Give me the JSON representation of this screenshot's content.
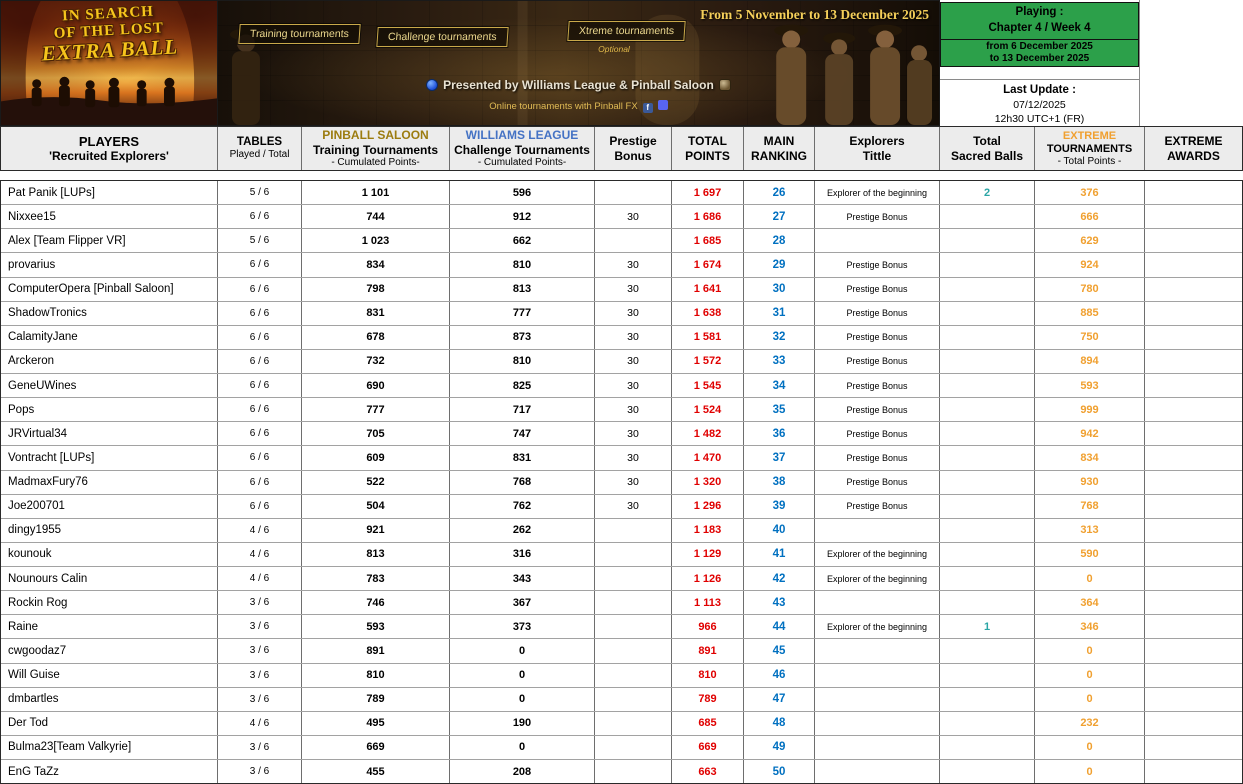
{
  "banner": {
    "left_poster": {
      "title_lines": [
        "IN SEARCH",
        "OF THE LOST",
        "EXTRA BALL"
      ]
    },
    "middle": {
      "date_range": "From 5 November to 13 December 2025",
      "tournament_labels": [
        "Training tournaments",
        "Challenge tournaments",
        "Xtreme tournaments"
      ],
      "xtreme_optional": "Optional",
      "presented_by": "Presented by Williams League & Pinball Saloon",
      "online_line": "Online tournaments with Pinball FX"
    },
    "right": {
      "playing_label": "Playing :",
      "playing_value": "Chapter 4 / Week 4",
      "playing_from": "from 6 December 2025",
      "playing_to": "to 13 December 2025",
      "last_update_label": "Last Update :",
      "last_update_date": "07/12/2025",
      "last_update_time": "12h30 UTC+1 (FR)"
    }
  },
  "icons": {
    "williams_league_icon": "circle-blue",
    "pinball_saloon_icon": "square-sepia",
    "facebook_icon": "f",
    "discord_icon": ""
  },
  "colors": {
    "total_points": "#e00000",
    "main_ranking": "#0070c0",
    "extreme": "#f0a030",
    "sacred_balls": "#2aa5a5",
    "pinball_saloon": "#9c7c10",
    "williams_league": "#4472c4",
    "playing_green": "#2ca04a"
  },
  "table": {
    "headers": {
      "players": {
        "line1": "PLAYERS",
        "line2": "'Recruited Explorers'"
      },
      "tables": {
        "line1": "TABLES",
        "line2": "Played / Total"
      },
      "training": {
        "brand": "PINBALL SALOON",
        "line2": "Training Tournaments",
        "line3": "- Cumulated Points-"
      },
      "challenge": {
        "brand": "WILLIAMS LEAGUE",
        "line2": "Challenge Tournaments",
        "line3": "- Cumulated Points-"
      },
      "prestige": {
        "line1": "Prestige",
        "line2": "Bonus"
      },
      "total": {
        "line1": "TOTAL",
        "line2": "POINTS"
      },
      "ranking": {
        "line1": "MAIN",
        "line2": "RANKING"
      },
      "explorers": {
        "line1": "Explorers",
        "line2": "Tittle"
      },
      "sacred": {
        "line1": "Total",
        "line2": "Sacred Balls"
      },
      "extreme": {
        "brand": "EXTREME",
        "line2": "TOURNAMENTS",
        "line3": "- Total Points -"
      },
      "awards": {
        "line1": "EXTREME",
        "line2": "AWARDS"
      }
    },
    "rows": [
      {
        "name": "Pat Panik [LUPs]",
        "tables": "5 / 6",
        "training": "1 101",
        "challenge": "596",
        "prestige": "",
        "total": "1 697",
        "ranking": "26",
        "title": "Explorer of the beginning",
        "sacred": "2",
        "extreme": "376",
        "awards": ""
      },
      {
        "name": "Nixxee15",
        "tables": "6 / 6",
        "training": "744",
        "challenge": "912",
        "prestige": "30",
        "total": "1 686",
        "ranking": "27",
        "title": "Prestige Bonus",
        "sacred": "",
        "extreme": "666",
        "awards": ""
      },
      {
        "name": "Alex [Team Flipper VR]",
        "tables": "5 / 6",
        "training": "1 023",
        "challenge": "662",
        "prestige": "",
        "total": "1 685",
        "ranking": "28",
        "title": "",
        "sacred": "",
        "extreme": "629",
        "awards": ""
      },
      {
        "name": "provarius",
        "tables": "6 / 6",
        "training": "834",
        "challenge": "810",
        "prestige": "30",
        "total": "1 674",
        "ranking": "29",
        "title": "Prestige Bonus",
        "sacred": "",
        "extreme": "924",
        "awards": ""
      },
      {
        "name": "ComputerOpera [Pinball Saloon]",
        "tables": "6 / 6",
        "training": "798",
        "challenge": "813",
        "prestige": "30",
        "total": "1 641",
        "ranking": "30",
        "title": "Prestige Bonus",
        "sacred": "",
        "extreme": "780",
        "awards": ""
      },
      {
        "name": "ShadowTronics",
        "tables": "6 / 6",
        "training": "831",
        "challenge": "777",
        "prestige": "30",
        "total": "1 638",
        "ranking": "31",
        "title": "Prestige Bonus",
        "sacred": "",
        "extreme": "885",
        "awards": ""
      },
      {
        "name": "CalamityJane",
        "tables": "6 / 6",
        "training": "678",
        "challenge": "873",
        "prestige": "30",
        "total": "1 581",
        "ranking": "32",
        "title": "Prestige Bonus",
        "sacred": "",
        "extreme": "750",
        "awards": ""
      },
      {
        "name": "Arckeron",
        "tables": "6 / 6",
        "training": "732",
        "challenge": "810",
        "prestige": "30",
        "total": "1 572",
        "ranking": "33",
        "title": "Prestige Bonus",
        "sacred": "",
        "extreme": "894",
        "awards": ""
      },
      {
        "name": "GeneUWines",
        "tables": "6 / 6",
        "training": "690",
        "challenge": "825",
        "prestige": "30",
        "total": "1 545",
        "ranking": "34",
        "title": "Prestige Bonus",
        "sacred": "",
        "extreme": "593",
        "awards": ""
      },
      {
        "name": "Pops",
        "tables": "6 / 6",
        "training": "777",
        "challenge": "717",
        "prestige": "30",
        "total": "1 524",
        "ranking": "35",
        "title": "Prestige Bonus",
        "sacred": "",
        "extreme": "999",
        "awards": ""
      },
      {
        "name": "JRVirtual34",
        "tables": "6 / 6",
        "training": "705",
        "challenge": "747",
        "prestige": "30",
        "total": "1 482",
        "ranking": "36",
        "title": "Prestige Bonus",
        "sacred": "",
        "extreme": "942",
        "awards": ""
      },
      {
        "name": "Vontracht [LUPs]",
        "tables": "6 / 6",
        "training": "609",
        "challenge": "831",
        "prestige": "30",
        "total": "1 470",
        "ranking": "37",
        "title": "Prestige Bonus",
        "sacred": "",
        "extreme": "834",
        "awards": ""
      },
      {
        "name": "MadmaxFury76",
        "tables": "6 / 6",
        "training": "522",
        "challenge": "768",
        "prestige": "30",
        "total": "1 320",
        "ranking": "38",
        "title": "Prestige Bonus",
        "sacred": "",
        "extreme": "930",
        "awards": ""
      },
      {
        "name": "Joe200701",
        "tables": "6 / 6",
        "training": "504",
        "challenge": "762",
        "prestige": "30",
        "total": "1 296",
        "ranking": "39",
        "title": "Prestige Bonus",
        "sacred": "",
        "extreme": "768",
        "awards": ""
      },
      {
        "name": "dingy1955",
        "tables": "4 / 6",
        "training": "921",
        "challenge": "262",
        "prestige": "",
        "total": "1 183",
        "ranking": "40",
        "title": "",
        "sacred": "",
        "extreme": "313",
        "awards": ""
      },
      {
        "name": "kounouk",
        "tables": "4 / 6",
        "training": "813",
        "challenge": "316",
        "prestige": "",
        "total": "1 129",
        "ranking": "41",
        "title": "Explorer of the beginning",
        "sacred": "",
        "extreme": "590",
        "awards": ""
      },
      {
        "name": "Nounours Calin",
        "tables": "4 / 6",
        "training": "783",
        "challenge": "343",
        "prestige": "",
        "total": "1 126",
        "ranking": "42",
        "title": "Explorer of the beginning",
        "sacred": "",
        "extreme": "0",
        "awards": ""
      },
      {
        "name": "Rockin Rog",
        "tables": "3 / 6",
        "training": "746",
        "challenge": "367",
        "prestige": "",
        "total": "1 113",
        "ranking": "43",
        "title": "",
        "sacred": "",
        "extreme": "364",
        "awards": ""
      },
      {
        "name": "Raine",
        "tables": "3 / 6",
        "training": "593",
        "challenge": "373",
        "prestige": "",
        "total": "966",
        "ranking": "44",
        "title": "Explorer of the beginning",
        "sacred": "1",
        "extreme": "346",
        "awards": ""
      },
      {
        "name": "cwgoodaz7",
        "tables": "3 / 6",
        "training": "891",
        "challenge": "0",
        "prestige": "",
        "total": "891",
        "ranking": "45",
        "title": "",
        "sacred": "",
        "extreme": "0",
        "awards": ""
      },
      {
        "name": "Will Guise",
        "tables": "3 / 6",
        "training": "810",
        "challenge": "0",
        "prestige": "",
        "total": "810",
        "ranking": "46",
        "title": "",
        "sacred": "",
        "extreme": "0",
        "awards": ""
      },
      {
        "name": "dmbartles",
        "tables": "3 / 6",
        "training": "789",
        "challenge": "0",
        "prestige": "",
        "total": "789",
        "ranking": "47",
        "title": "",
        "sacred": "",
        "extreme": "0",
        "awards": ""
      },
      {
        "name": "Der Tod",
        "tables": "4 / 6",
        "training": "495",
        "challenge": "190",
        "prestige": "",
        "total": "685",
        "ranking": "48",
        "title": "",
        "sacred": "",
        "extreme": "232",
        "awards": ""
      },
      {
        "name": "Bulma23[Team Valkyrie]",
        "tables": "3 / 6",
        "training": "669",
        "challenge": "0",
        "prestige": "",
        "total": "669",
        "ranking": "49",
        "title": "",
        "sacred": "",
        "extreme": "0",
        "awards": ""
      },
      {
        "name": "EnG TaZz",
        "tables": "3 / 6",
        "training": "455",
        "challenge": "208",
        "prestige": "",
        "total": "663",
        "ranking": "50",
        "title": "",
        "sacred": "",
        "extreme": "0",
        "awards": ""
      }
    ]
  }
}
